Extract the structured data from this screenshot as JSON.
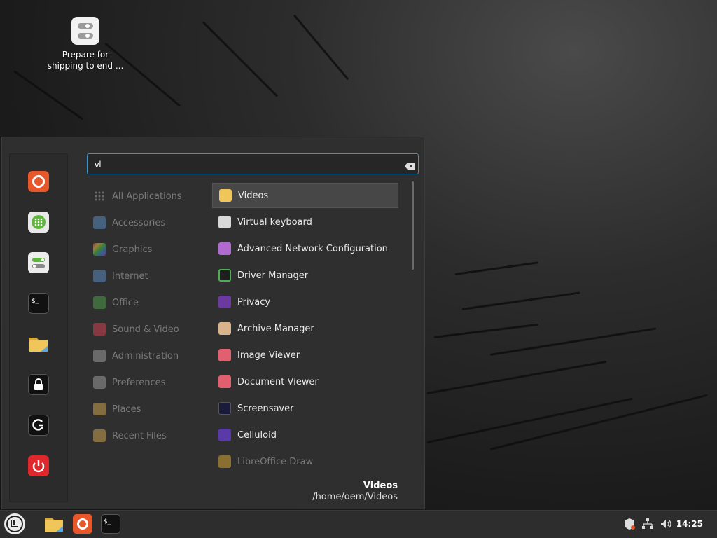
{
  "desktop": {
    "icon": {
      "name": "toggles-icon",
      "label_line1": "Prepare for",
      "label_line2": "shipping to end ..."
    }
  },
  "menu": {
    "search": {
      "value": "vl",
      "clear_icon": "backspace-clear-icon"
    },
    "favorites": [
      {
        "name": "firefox-icon",
        "color": "#e8572a"
      },
      {
        "name": "software-manager-icon",
        "color": "#5fb63f"
      },
      {
        "name": "settings-toggles-icon",
        "color": "#ececec"
      },
      {
        "name": "terminal-icon",
        "color": "#111111"
      },
      {
        "name": "files-icon",
        "color": "#f0c55a"
      },
      {
        "name": "lock-icon",
        "color": "#111111"
      },
      {
        "name": "logout-icon",
        "color": "#111111"
      },
      {
        "name": "power-icon",
        "color": "#e0272c"
      }
    ],
    "categories": [
      {
        "label": "All Applications",
        "icon": "grid-icon"
      },
      {
        "label": "Accessories",
        "icon": "scissors-icon"
      },
      {
        "label": "Graphics",
        "icon": "graphics-icon"
      },
      {
        "label": "Internet",
        "icon": "cloud-icon"
      },
      {
        "label": "Office",
        "icon": "office-icon"
      },
      {
        "label": "Sound & Video",
        "icon": "play-icon"
      },
      {
        "label": "Administration",
        "icon": "admin-icon"
      },
      {
        "label": "Preferences",
        "icon": "preferences-icon"
      },
      {
        "label": "Places",
        "icon": "folder-icon"
      },
      {
        "label": "Recent Files",
        "icon": "recent-icon"
      }
    ],
    "apps": [
      {
        "label": "Videos",
        "icon": "videos-folder-icon",
        "color": "#f0c55a"
      },
      {
        "label": "Virtual keyboard",
        "icon": "keyboard-icon",
        "color": "#d8d8d8"
      },
      {
        "label": "Advanced Network Configuration",
        "icon": "network-icon",
        "color": "#b06ad0"
      },
      {
        "label": "Driver Manager",
        "icon": "chip-icon",
        "color": "#4caf50"
      },
      {
        "label": "Privacy",
        "icon": "mask-icon",
        "color": "#6a3aa0"
      },
      {
        "label": "Archive Manager",
        "icon": "archive-icon",
        "color": "#d9b48a"
      },
      {
        "label": "Image Viewer",
        "icon": "image-icon",
        "color": "#e06070"
      },
      {
        "label": "Document Viewer",
        "icon": "glasses-icon",
        "color": "#e06070"
      },
      {
        "label": "Screensaver",
        "icon": "moon-icon",
        "color": "#1a1a3a"
      },
      {
        "label": "Celluloid",
        "icon": "celluloid-icon",
        "color": "#5a3aa8"
      },
      {
        "label": "LibreOffice Draw",
        "icon": "draw-icon",
        "color": "#c8a030"
      }
    ],
    "info": {
      "title": "Videos",
      "path": "/home/oem/Videos"
    }
  },
  "panel": {
    "menu_button": "mint-menu-icon",
    "launchers": [
      {
        "name": "files-icon",
        "color": "#f0c55a"
      },
      {
        "name": "firefox-icon",
        "color": "#e8572a"
      },
      {
        "name": "terminal-icon",
        "color": "#111111"
      }
    ],
    "tray": [
      "shield-update-icon",
      "network-icon",
      "volume-icon"
    ],
    "clock": "14:25"
  }
}
